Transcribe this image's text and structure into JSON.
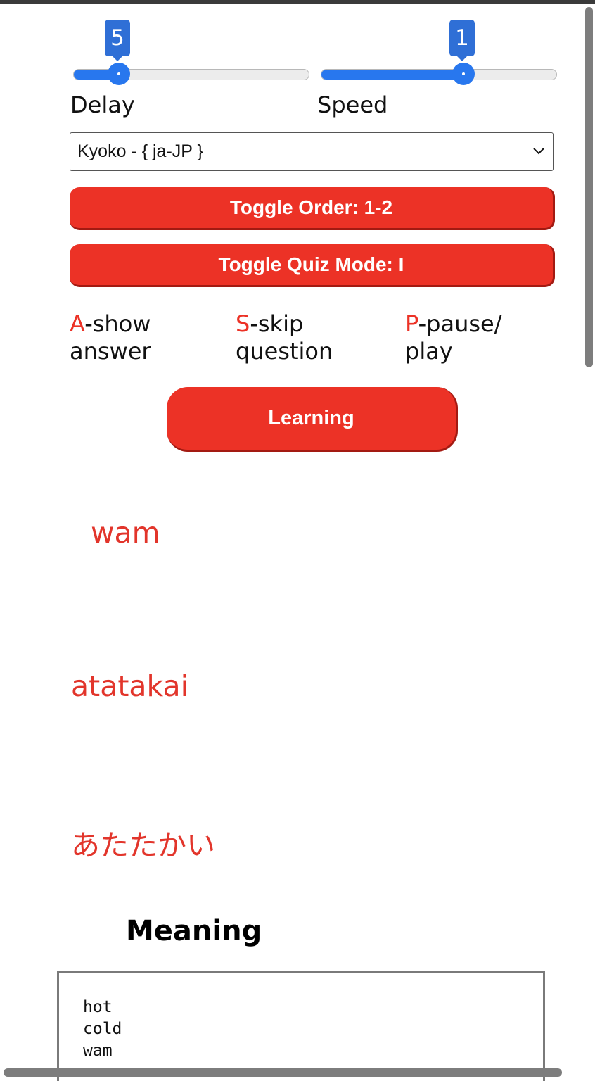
{
  "sliders": {
    "delay": {
      "label": "Delay",
      "value": "5",
      "level": 0.2
    },
    "speed": {
      "label": "Speed",
      "value": "1",
      "level": 0.6
    }
  },
  "voice_select": {
    "selected": "Kyoko - { ja-JP }"
  },
  "buttons": {
    "toggle_order": "Toggle Order: 1-2",
    "toggle_quiz_mode": "Toggle Quiz Mode: I",
    "learning": "Learning"
  },
  "shortcuts": [
    {
      "key": "A",
      "rest": "-show",
      "line2": "answer"
    },
    {
      "key": "S",
      "rest": "-skip",
      "line2": "question"
    },
    {
      "key": "P",
      "rest": "-pause/",
      "line2": "play"
    }
  ],
  "words": {
    "english": "wam",
    "romaji": "atatakai",
    "kana": "あたたかい"
  },
  "meaning": {
    "title": "Meaning",
    "text": "hot\ncold\nwam"
  },
  "colors": {
    "accent_red": "#ec3226",
    "slider_blue": "#2877ee"
  }
}
